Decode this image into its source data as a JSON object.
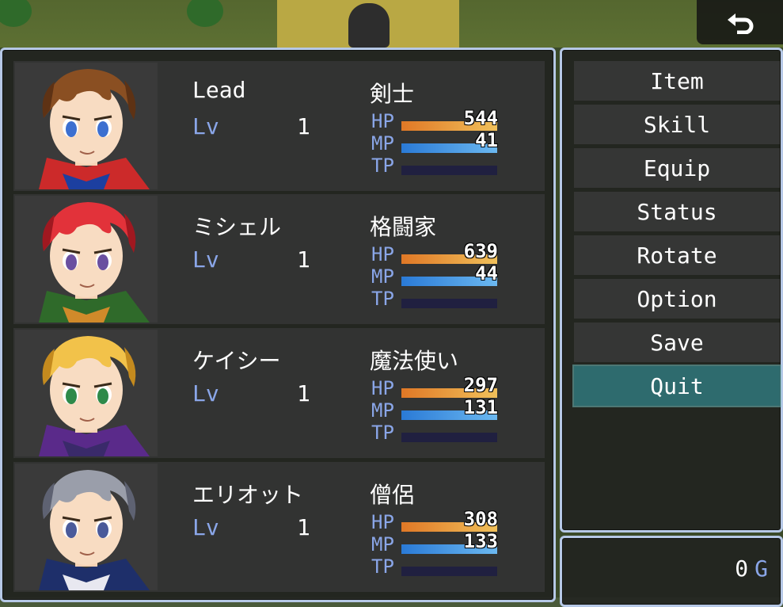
{
  "back_button": {
    "icon": "return-arrow-icon"
  },
  "actors": [
    {
      "name": "Lead",
      "lv_label": "Lv",
      "level": "1",
      "class": "剣士",
      "hp_label": "HP",
      "hp": "544",
      "hp_ratio": 1.0,
      "mp_label": "MP",
      "mp": "41",
      "mp_ratio": 1.0,
      "tp_label": "TP",
      "tp_ratio": 0,
      "face": {
        "hair": "#8a4f22",
        "hair_dark": "#5e3214",
        "eyes": "#3c6fd0",
        "cloth": "#cc2a2a",
        "cloth2": "#1c3fa0"
      }
    },
    {
      "name": "ミシェル",
      "lv_label": "Lv",
      "level": "1",
      "class": "格闘家",
      "hp_label": "HP",
      "hp": "639",
      "hp_ratio": 1.0,
      "mp_label": "MP",
      "mp": "44",
      "mp_ratio": 1.0,
      "tp_label": "TP",
      "tp_ratio": 0,
      "face": {
        "hair": "#e2323a",
        "hair_dark": "#a01820",
        "eyes": "#6a4fa0",
        "cloth": "#2f6a2a",
        "cloth2": "#d08a2a"
      }
    },
    {
      "name": "ケイシー",
      "lv_label": "Lv",
      "level": "1",
      "class": "魔法使い",
      "hp_label": "HP",
      "hp": "297",
      "hp_ratio": 1.0,
      "mp_label": "MP",
      "mp": "131",
      "mp_ratio": 1.0,
      "tp_label": "TP",
      "tp_ratio": 0,
      "face": {
        "hair": "#f2c24a",
        "hair_dark": "#c48a1e",
        "eyes": "#2e8a4a",
        "cloth": "#5a2a8a",
        "cloth2": "#3a2a6a"
      }
    },
    {
      "name": "エリオット",
      "lv_label": "Lv",
      "level": "1",
      "class": "僧侶",
      "hp_label": "HP",
      "hp": "308",
      "hp_ratio": 1.0,
      "mp_label": "MP",
      "mp": "133",
      "mp_ratio": 1.0,
      "tp_label": "TP",
      "tp_ratio": 0,
      "face": {
        "hair": "#9a9eaa",
        "hair_dark": "#5e6272",
        "eyes": "#4a5a9a",
        "cloth": "#1e2f6a",
        "cloth2": "#e8e8f0"
      }
    }
  ],
  "commands": [
    {
      "label": "Item",
      "selected": false
    },
    {
      "label": "Skill",
      "selected": false
    },
    {
      "label": "Equip",
      "selected": false
    },
    {
      "label": "Status",
      "selected": false
    },
    {
      "label": "Rotate",
      "selected": false
    },
    {
      "label": "Option",
      "selected": false
    },
    {
      "label": "Save",
      "selected": false
    },
    {
      "label": "Quit",
      "selected": true
    }
  ],
  "gold": {
    "value": "0",
    "unit": "G"
  }
}
